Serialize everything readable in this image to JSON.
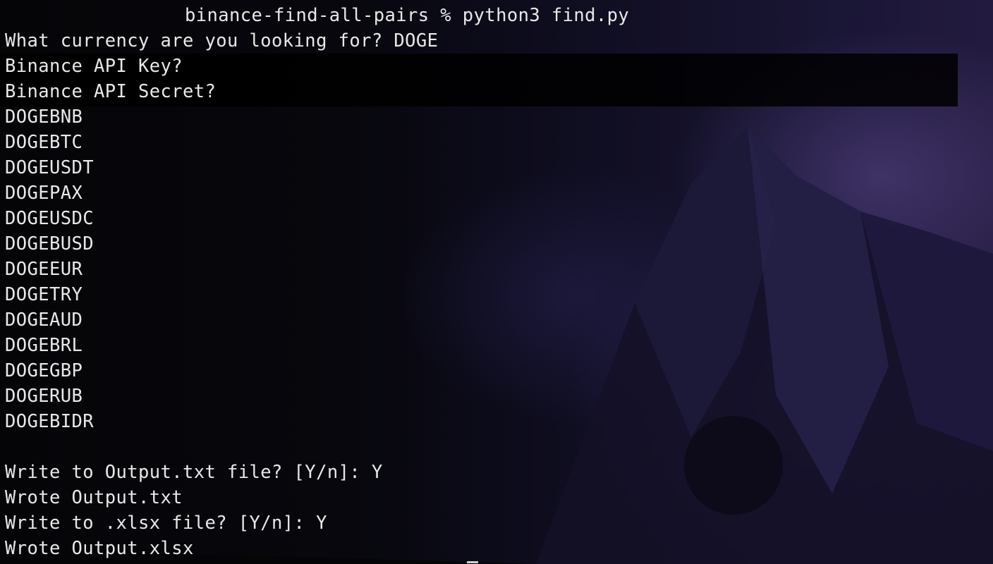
{
  "terminal": {
    "prompt_line": "binance-find-all-pairs % python3 find.py",
    "lines": [
      "What currency are you looking for? DOGE",
      "Binance API Key?",
      "Binance API Secret?",
      "DOGEBNB",
      "DOGEBTC",
      "DOGEUSDT",
      "DOGEPAX",
      "DOGEUSDC",
      "DOGEBUSD",
      "DOGEEUR",
      "DOGETRY",
      "DOGEAUD",
      "DOGEBRL",
      "DOGEGBP",
      "DOGERUB",
      "DOGEBIDR",
      "",
      "Write to Output.txt file? [Y/n]: Y",
      "Wrote Output.txt",
      "Write to .xlsx file? [Y/n]: Y",
      "Wrote Output.xlsx"
    ]
  },
  "colors": {
    "text": "#e8e8e8",
    "background": "#000000",
    "wallpaper_accent": "#3a2e70"
  }
}
